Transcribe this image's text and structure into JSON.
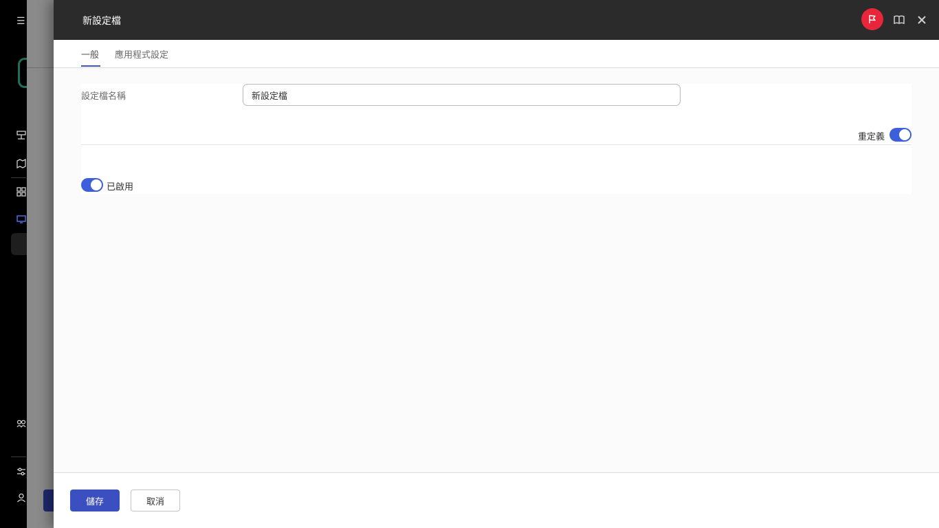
{
  "drawer": {
    "title": "新設定檔"
  },
  "header_icons": {
    "flag": "flag-icon",
    "book": "book-icon",
    "close": "close-icon",
    "flag_color": "#e8263b"
  },
  "tabs": [
    {
      "label": "一般",
      "active": true
    },
    {
      "label": "應用程式設定",
      "active": false
    }
  ],
  "form": {
    "name_label": "設定檔名稱",
    "name_value": "新設定檔",
    "override_label": "重定義",
    "override_on": true,
    "enabled_label": "已啟用",
    "enabled_on": true
  },
  "footer": {
    "save_label": "儲存",
    "cancel_label": "取消"
  },
  "colors": {
    "accent": "#3b4fc0",
    "toggle": "#3d5fd9",
    "header_bg": "#2b2b2b"
  },
  "background_app": {
    "nav_icons": [
      "menu-icon",
      "network-icon",
      "map-icon",
      "apps-icon",
      "monitor-icon",
      "users-icon",
      "settings-sliders-icon",
      "user-icon"
    ]
  }
}
